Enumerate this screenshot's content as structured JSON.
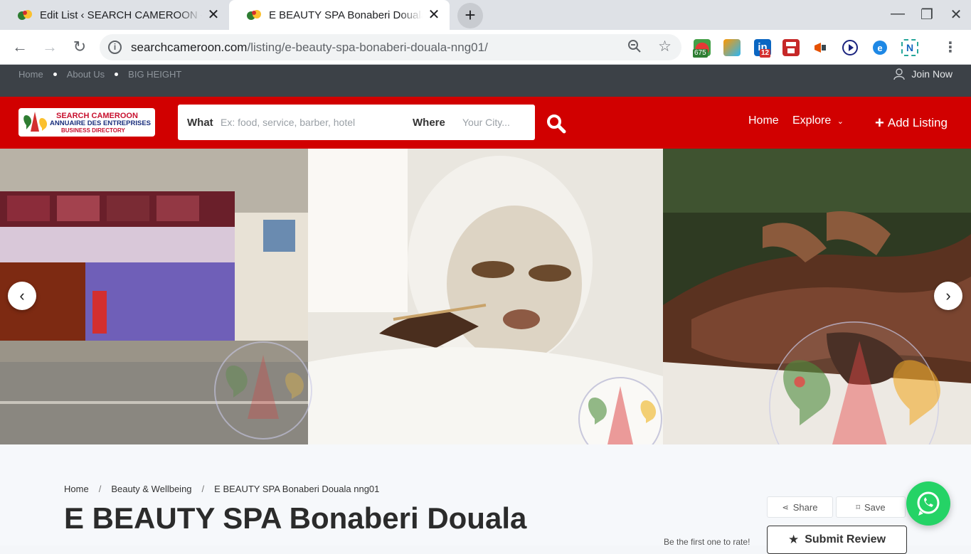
{
  "browser": {
    "tabs": [
      {
        "title": "Edit List ‹ SEARCH CAMEROON —",
        "active": false
      },
      {
        "title": "E BEAUTY SPA Bonaberi Douala n",
        "active": true
      }
    ],
    "url_host": "searchcameroon.com",
    "url_path": "/listing/e-beauty-spa-bonaberi-douala-nng01/",
    "extension_badges": {
      "badge_1": "675",
      "badge_2": "12"
    }
  },
  "site": {
    "topbar": {
      "links": [
        "Home",
        "About Us",
        "BIG HEIGHT"
      ],
      "join": "Join Now"
    },
    "logo": {
      "line1": "SEARCH CAMEROON",
      "line2": "ANNUAIRE DES ENTREPRISES",
      "line3": "BUSINESS DIRECTORY"
    },
    "search": {
      "what_label": "What",
      "what_placeholder": "Ex: food, service, barber, hotel",
      "where_label": "Where",
      "where_placeholder": "Your City..."
    },
    "nav": {
      "home": "Home",
      "explore": "Explore",
      "add_listing": "Add Listing"
    }
  },
  "listing": {
    "breadcrumb": [
      "Home",
      "Beauty & Wellbeing",
      "E BEAUTY SPA Bonaberi Douala nng01"
    ],
    "title": "E BEAUTY SPA Bonaberi Douala",
    "share_label": "Share",
    "save_label": "Save",
    "rate_text": "Be the first one to rate!",
    "submit_review": "Submit Review"
  },
  "colors": {
    "brand_red": "#d10000",
    "topbar_dark": "#3c4147",
    "whatsapp_green": "#25d366"
  }
}
